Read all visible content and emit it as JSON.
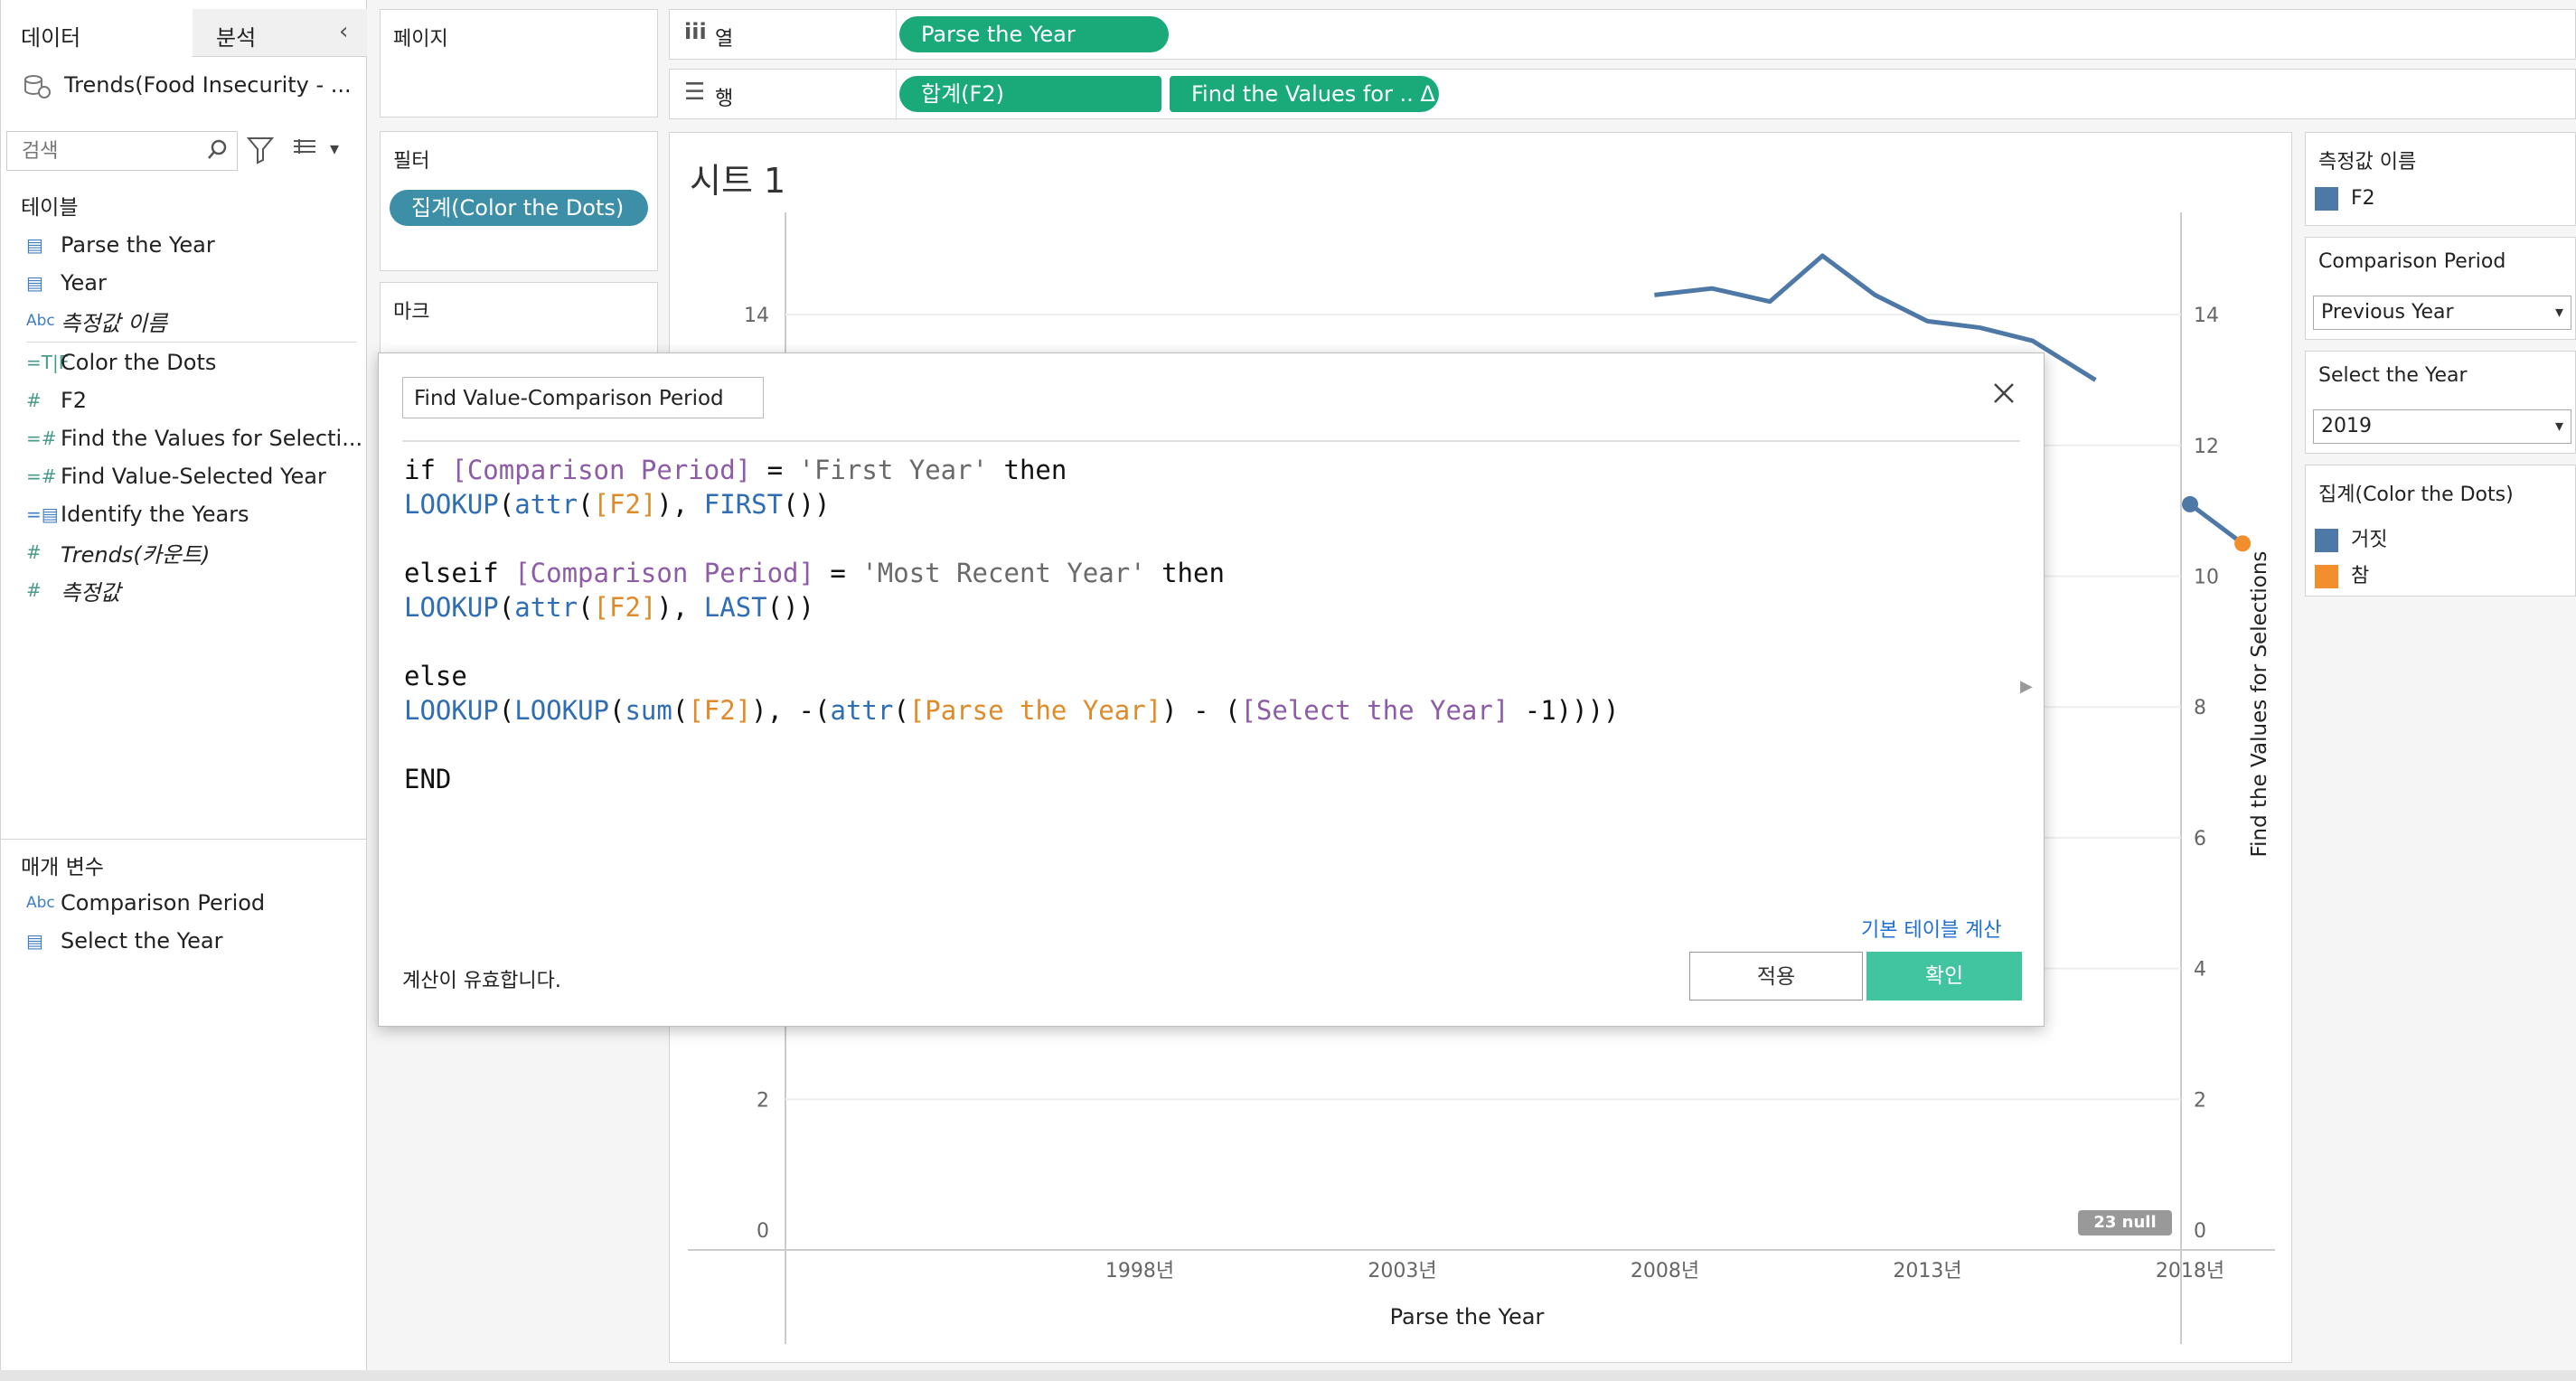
{
  "left_panel": {
    "tab_data": "데이터",
    "tab_analysis": "분석",
    "datasource": "Trends(Food Insecurity - ...",
    "search_placeholder": "검색",
    "tables_header": "테이블",
    "fields": [
      {
        "icon": "date-icon",
        "name": "Parse the Year"
      },
      {
        "icon": "date-icon",
        "name": "Year"
      },
      {
        "icon": "abc-icon",
        "name": "측정값 이름"
      },
      {
        "icon": "calc-icon",
        "name": "Color the Dots"
      },
      {
        "icon": "measure-icon",
        "name": "F2"
      },
      {
        "icon": "calc-icon",
        "name": "Find the Values for Selecti..."
      },
      {
        "icon": "calc-icon",
        "name": "Find Value-Selected Year"
      },
      {
        "icon": "date-icon",
        "name": "Identify the Years"
      },
      {
        "icon": "measure-icon",
        "name": "Trends(카운트)"
      },
      {
        "icon": "measure-icon",
        "name": "측정값"
      }
    ],
    "params_header": "매개 변수",
    "params": [
      {
        "icon": "abc-icon",
        "name": "Comparison Period"
      },
      {
        "icon": "date-icon",
        "name": "Select the Year"
      }
    ]
  },
  "shelves": {
    "pages_label": "페이지",
    "filters_label": "필터",
    "filter_pill": "집계(Color the Dots)",
    "marks_label": "마크",
    "columns_label": "열",
    "rows_label": "행",
    "columns_pills": [
      "Parse the Year"
    ],
    "rows_pills": [
      "합계(F2)",
      "Find the Values for .. Δ"
    ]
  },
  "sheet": {
    "title": "시트 1",
    "xlabel": "Parse the Year",
    "ylabel_right": "Find the Values for Selections",
    "null_badge": "23 null"
  },
  "chart_data": {
    "type": "line",
    "x_ticks": [
      "1998년",
      "2003년",
      "2008년",
      "2013년",
      "2018년"
    ],
    "left_y_ticks": [
      "0",
      "2",
      "14"
    ],
    "right_y_ticks": [
      "0",
      "2",
      "4",
      "6",
      "8",
      "10",
      "12",
      "14"
    ],
    "ylim": [
      0,
      15
    ],
    "visible_line_f2": {
      "x": [
        2007.8,
        2008.9,
        2010,
        2011,
        2012,
        2013,
        2014,
        2015,
        2016.2
      ],
      "y": [
        14.3,
        14.4,
        14.2,
        14.9,
        14.3,
        13.9,
        13.8,
        13.6,
        13.0
      ]
    },
    "visible_line_tail": {
      "x": [
        2018,
        2019
      ],
      "y": [
        11.1,
        10.5
      ]
    },
    "dots": [
      {
        "x": 2018,
        "y": 11.1,
        "color": "#4e79a7"
      },
      {
        "x": 2019,
        "y": 10.5,
        "color": "#f28e2b"
      }
    ]
  },
  "dialog": {
    "name": "Find Value-Comparison Period",
    "code_lines": [
      [
        {
          "c": "kw",
          "t": "if "
        },
        {
          "c": "par",
          "t": "[Comparison Period]"
        },
        {
          "c": "kw",
          "t": " = "
        },
        {
          "c": "str",
          "t": "'First Year'"
        },
        {
          "c": "kw",
          "t": " then"
        }
      ],
      [
        {
          "c": "fn",
          "t": "LOOKUP"
        },
        {
          "c": "kw",
          "t": "("
        },
        {
          "c": "fn",
          "t": "attr"
        },
        {
          "c": "kw",
          "t": "("
        },
        {
          "c": "fld",
          "t": "[F2]"
        },
        {
          "c": "kw",
          "t": "), "
        },
        {
          "c": "fn",
          "t": "FIRST"
        },
        {
          "c": "kw",
          "t": "())"
        }
      ],
      [],
      [
        {
          "c": "kw",
          "t": "elseif "
        },
        {
          "c": "par",
          "t": "[Comparison Period]"
        },
        {
          "c": "kw",
          "t": " = "
        },
        {
          "c": "str",
          "t": "'Most Recent Year'"
        },
        {
          "c": "kw",
          "t": " then"
        }
      ],
      [
        {
          "c": "fn",
          "t": "LOOKUP"
        },
        {
          "c": "kw",
          "t": "("
        },
        {
          "c": "fn",
          "t": "attr"
        },
        {
          "c": "kw",
          "t": "("
        },
        {
          "c": "fld",
          "t": "[F2]"
        },
        {
          "c": "kw",
          "t": "), "
        },
        {
          "c": "fn",
          "t": "LAST"
        },
        {
          "c": "kw",
          "t": "())"
        }
      ],
      [],
      [
        {
          "c": "kw",
          "t": "else"
        }
      ],
      [
        {
          "c": "fn",
          "t": "LOOKUP"
        },
        {
          "c": "kw",
          "t": "("
        },
        {
          "c": "fn",
          "t": "LOOKUP"
        },
        {
          "c": "kw",
          "t": "("
        },
        {
          "c": "fn",
          "t": "sum"
        },
        {
          "c": "kw",
          "t": "("
        },
        {
          "c": "fld",
          "t": "[F2]"
        },
        {
          "c": "kw",
          "t": "), -("
        },
        {
          "c": "fn",
          "t": "attr"
        },
        {
          "c": "kw",
          "t": "("
        },
        {
          "c": "fld",
          "t": "[Parse the Year]"
        },
        {
          "c": "kw",
          "t": ") - ("
        },
        {
          "c": "par",
          "t": "[Select the Year]"
        },
        {
          "c": "kw",
          "t": " -1))))"
        }
      ],
      [],
      [
        {
          "c": "kw",
          "t": "END"
        }
      ]
    ],
    "default_table_calc_link": "기본 테이블 계산",
    "status": "계산이 유효합니다.",
    "apply_label": "적용",
    "ok_label": "확인"
  },
  "right_panel": {
    "measure_names_title": "측정값 이름",
    "measure_names_items": [
      {
        "label": "F2",
        "color": "#4e79a7"
      }
    ],
    "comparison_title": "Comparison Period",
    "comparison_value": "Previous Year",
    "select_year_title": "Select the Year",
    "select_year_value": "2019",
    "color_legend_title": "집계(Color the Dots)",
    "color_legend_items": [
      {
        "label": "거짓",
        "color": "#4e79a7"
      },
      {
        "label": "참",
        "color": "#f28e2b"
      }
    ]
  },
  "colors": {
    "pill_green": "#1aaa7a",
    "pill_teal": "#3d8fa8",
    "ok_button": "#41c5a1",
    "link_blue": "#1f6fcf"
  }
}
